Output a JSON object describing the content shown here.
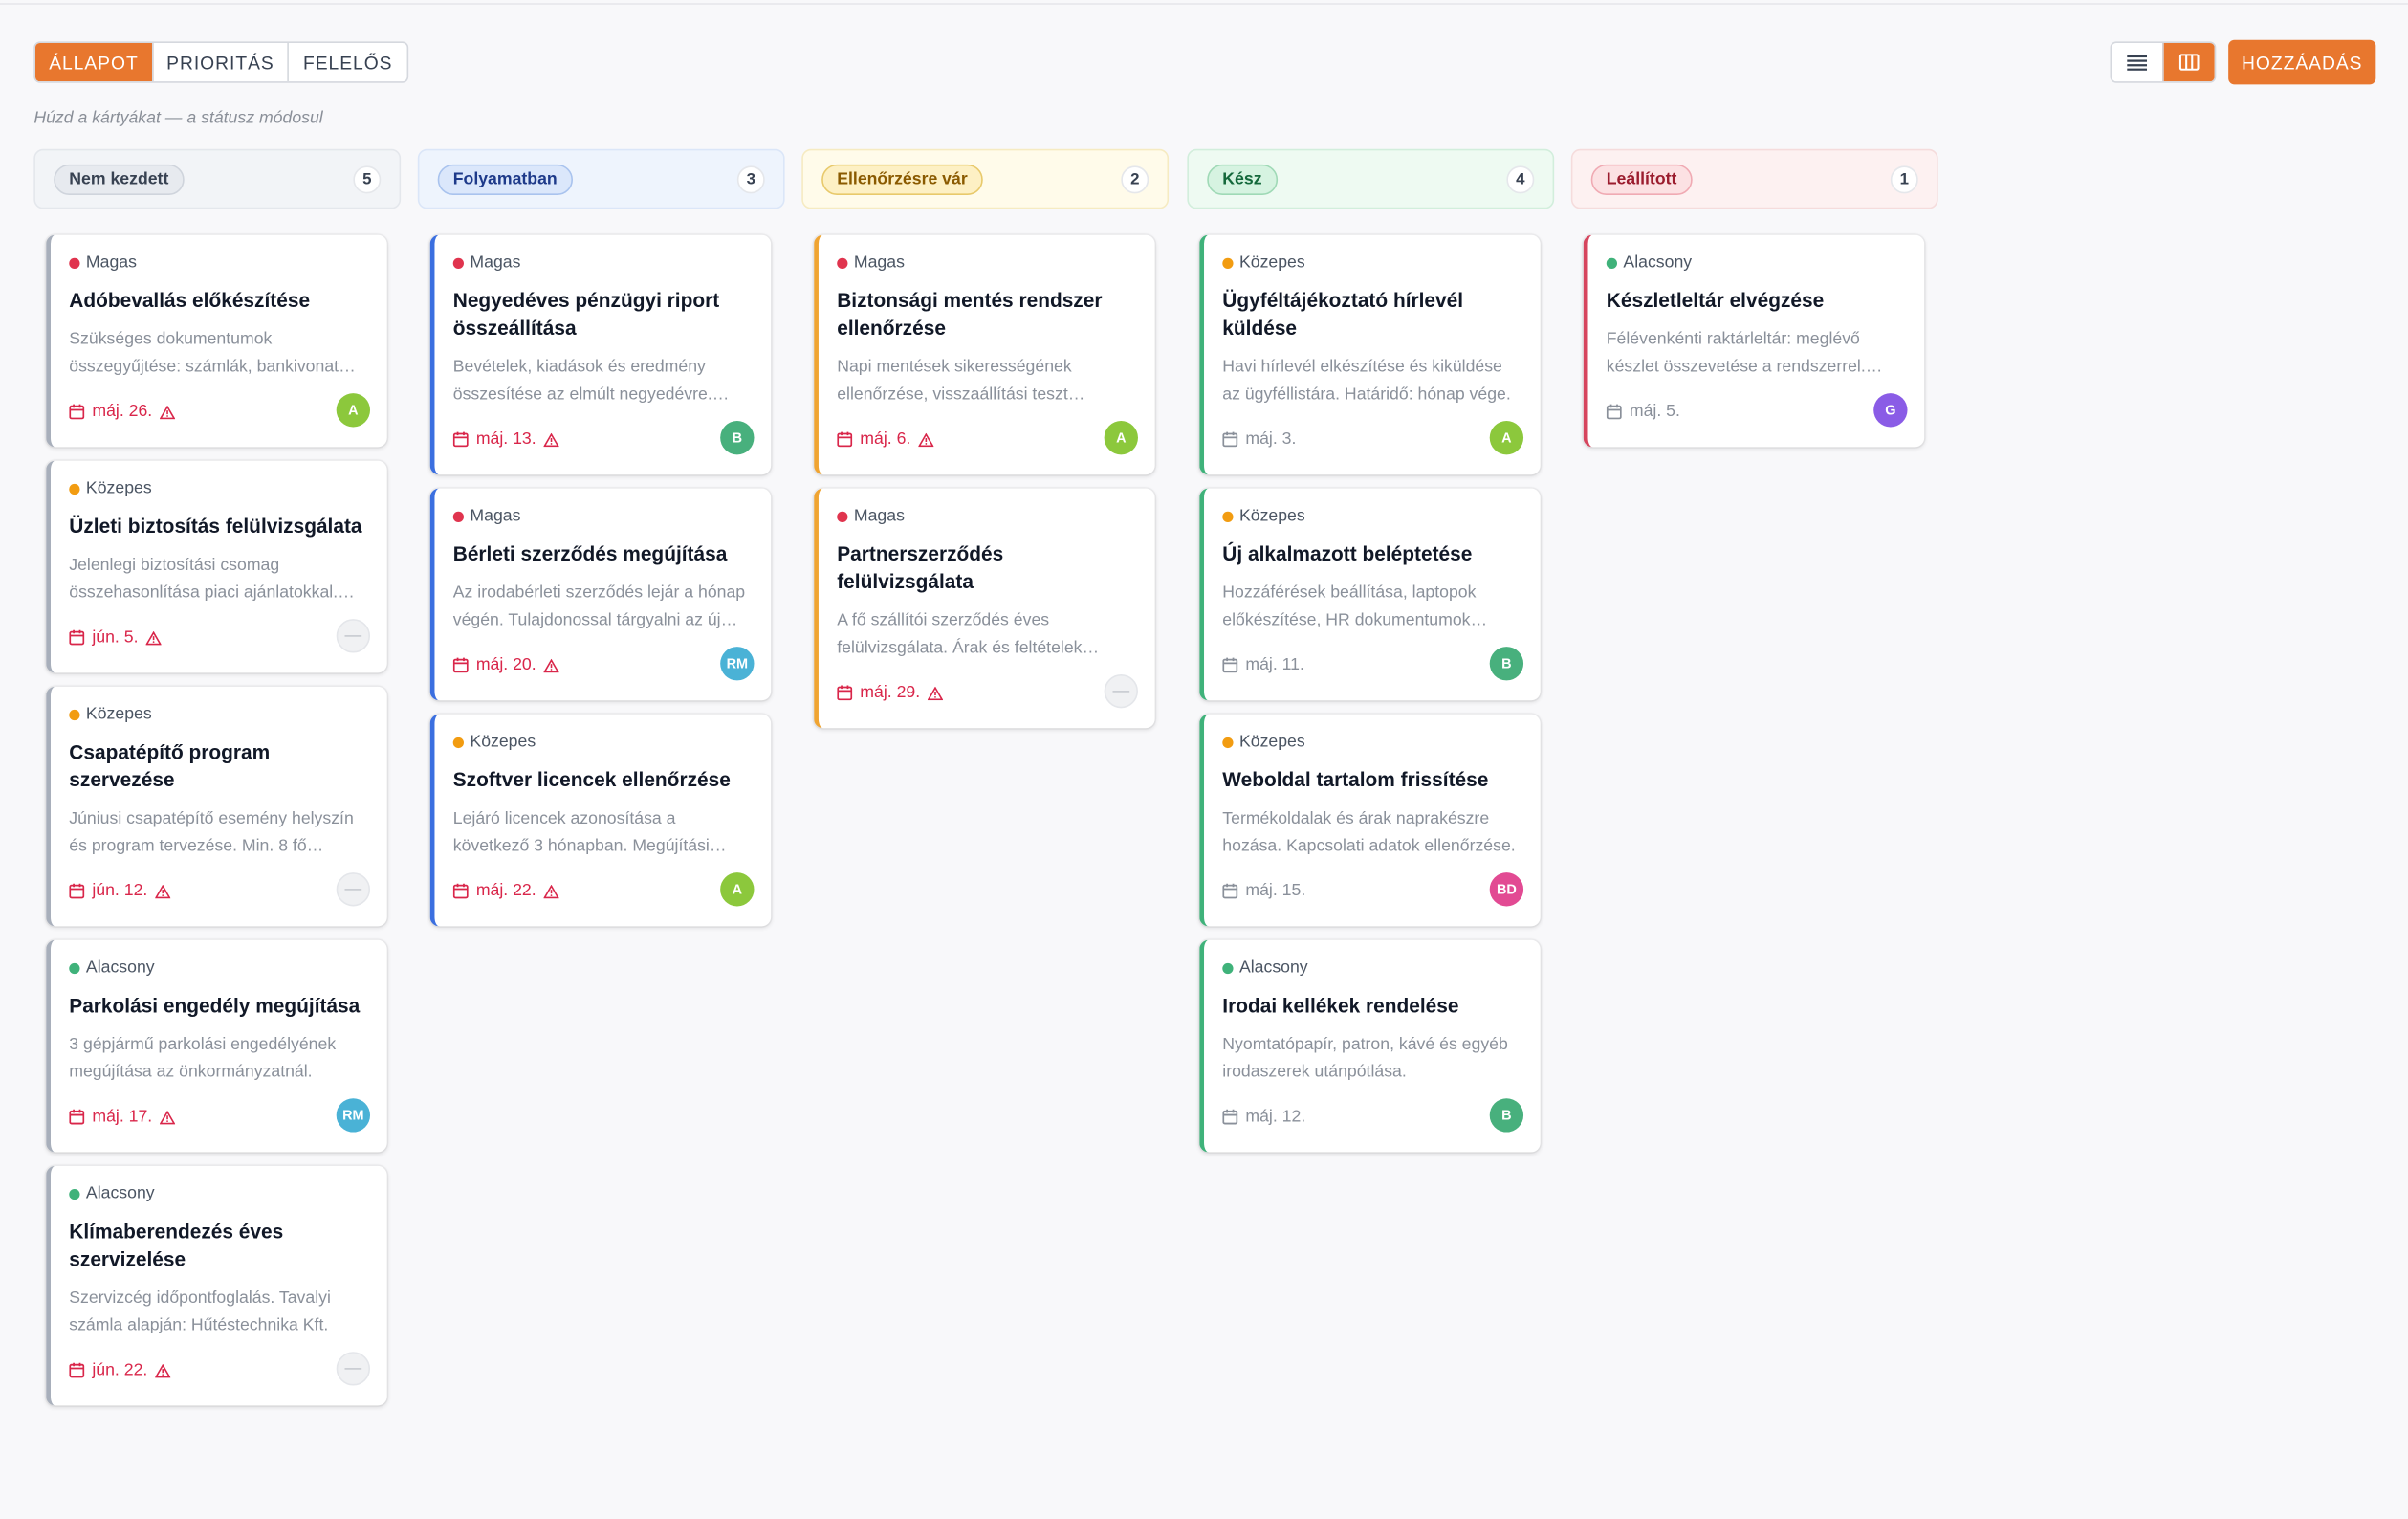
{
  "toolbar": {
    "group_tabs": [
      {
        "label": "ÁLLAPOT",
        "active": true
      },
      {
        "label": "PRIORITÁS",
        "active": false
      },
      {
        "label": "FELELŐS",
        "active": false
      }
    ],
    "hint": "Húzd a kártyákat — a státusz módosul",
    "view_modes": [
      {
        "icon": "list-view-icon",
        "active": false
      },
      {
        "icon": "board-view-icon",
        "active": true
      }
    ],
    "add_label": "HOZZÁADÁS"
  },
  "colors": {
    "accent": "#e8772e",
    "priority_high": "#e0344e",
    "priority_medium": "#f29c11",
    "priority_low": "#3fb27a",
    "overdue": "#d9264a"
  },
  "columns": [
    {
      "status": "Nem kezdett",
      "count": "5",
      "cards": [
        {
          "priority": "Magas",
          "title": "Adóbevallás előkészítése",
          "desc": [
            "Szükséges dokumentumok",
            "összegyűjtése: számlák, bankivonat…"
          ],
          "due": "máj. 26.",
          "overdue": true,
          "assignee": "A"
        },
        {
          "priority": "Közepes",
          "title": "Üzleti biztosítás felülvizsgálata",
          "desc": [
            "Jelenlegi biztosítási csomag",
            "összehasonlítása piaci ajánlatokkal.…"
          ],
          "due": "jún. 5.",
          "overdue": true,
          "assignee": "—"
        },
        {
          "priority": "Közepes",
          "title": "Csapatépítő program szervezése",
          "desc": [
            "Júniusi csapatépítő esemény helyszín",
            "és program tervezése. Min. 8 fő…"
          ],
          "due": "jún. 12.",
          "overdue": true,
          "assignee": "—"
        },
        {
          "priority": "Alacsony",
          "title": "Parkolási engedély megújítása",
          "desc": [
            "3 gépjármű parkolási engedélyének",
            "megújítása az önkormányzatnál."
          ],
          "due": "máj. 17.",
          "overdue": true,
          "assignee": "RM"
        },
        {
          "priority": "Alacsony",
          "title": "Klímaberendezés éves szervizelése",
          "desc": [
            "Szervizcég időpontfoglalás. Tavalyi",
            "számla alapján: Hűtéstechnika Kft."
          ],
          "due": "jún. 22.",
          "overdue": true,
          "assignee": "—"
        }
      ]
    },
    {
      "status": "Folyamatban",
      "count": "3",
      "cards": [
        {
          "priority": "Magas",
          "title": "Negyedéves pénzügyi riport összeállítása",
          "desc": [
            "Bevételek, kiadások és eredmény",
            "összesítése az elmúlt negyedévre.…"
          ],
          "due": "máj. 13.",
          "overdue": true,
          "assignee": "B"
        },
        {
          "priority": "Magas",
          "title": "Bérleti szerződés megújítása",
          "desc": [
            "Az irodabérleti szerződés lejár a hónap",
            "végén. Tulajdonossal tárgyalni az új…"
          ],
          "due": "máj. 20.",
          "overdue": true,
          "assignee": "RM"
        },
        {
          "priority": "Közepes",
          "title": "Szoftver licencek ellenőrzése",
          "desc": [
            "Lejáró licencek azonosítása a",
            "következő 3 hónapban. Megújítási…"
          ],
          "due": "máj. 22.",
          "overdue": true,
          "assignee": "A"
        }
      ]
    },
    {
      "status": "Ellenőrzésre vár",
      "count": "2",
      "cards": [
        {
          "priority": "Magas",
          "title": "Biztonsági mentés rendszer ellenőrzése",
          "desc": [
            "Napi mentések sikerességének",
            "ellenőrzése, visszaállítási teszt…"
          ],
          "due": "máj. 6.",
          "overdue": true,
          "assignee": "A"
        },
        {
          "priority": "Magas",
          "title": "Partnerszerződés felülvizsgálata",
          "desc": [
            "A fő szállítói szerződés éves",
            "felülvizsgálata. Árak és feltételek…"
          ],
          "due": "máj. 29.",
          "overdue": true,
          "assignee": "—"
        }
      ]
    },
    {
      "status": "Kész",
      "count": "4",
      "cards": [
        {
          "priority": "Közepes",
          "title": "Ügyféltájékoztató hírlevél küldése",
          "desc": [
            "Havi hírlevél elkészítése és kiküldése",
            "az ügyféllistára. Határidő: hónap vége."
          ],
          "due": "máj. 3.",
          "overdue": false,
          "assignee": "A"
        },
        {
          "priority": "Közepes",
          "title": "Új alkalmazott beléptetése",
          "desc": [
            "Hozzáférések beállítása, laptopok",
            "előkészítése, HR dokumentumok…"
          ],
          "due": "máj. 11.",
          "overdue": false,
          "assignee": "B"
        },
        {
          "priority": "Közepes",
          "title": "Weboldal tartalom frissítése",
          "desc": [
            "Termékoldalak és árak naprakészre",
            "hozása. Kapcsolati adatok ellenőrzése."
          ],
          "due": "máj. 15.",
          "overdue": false,
          "assignee": "BD"
        },
        {
          "priority": "Alacsony",
          "title": "Irodai kellékek rendelése",
          "desc": [
            "Nyomtatópapír, patron, kávé és egyéb",
            "irodaszerek utánpótlása."
          ],
          "due": "máj. 12.",
          "overdue": false,
          "assignee": "B"
        }
      ]
    },
    {
      "status": "Leállított",
      "count": "1",
      "cards": [
        {
          "priority": "Alacsony",
          "title": "Készletleltár elvégzése",
          "desc": [
            "Félévenkénti raktárleltár: meglévő",
            "készlet összevetése a rendszerrel.…"
          ],
          "due": "máj. 5.",
          "overdue": false,
          "assignee": "G"
        }
      ]
    }
  ]
}
